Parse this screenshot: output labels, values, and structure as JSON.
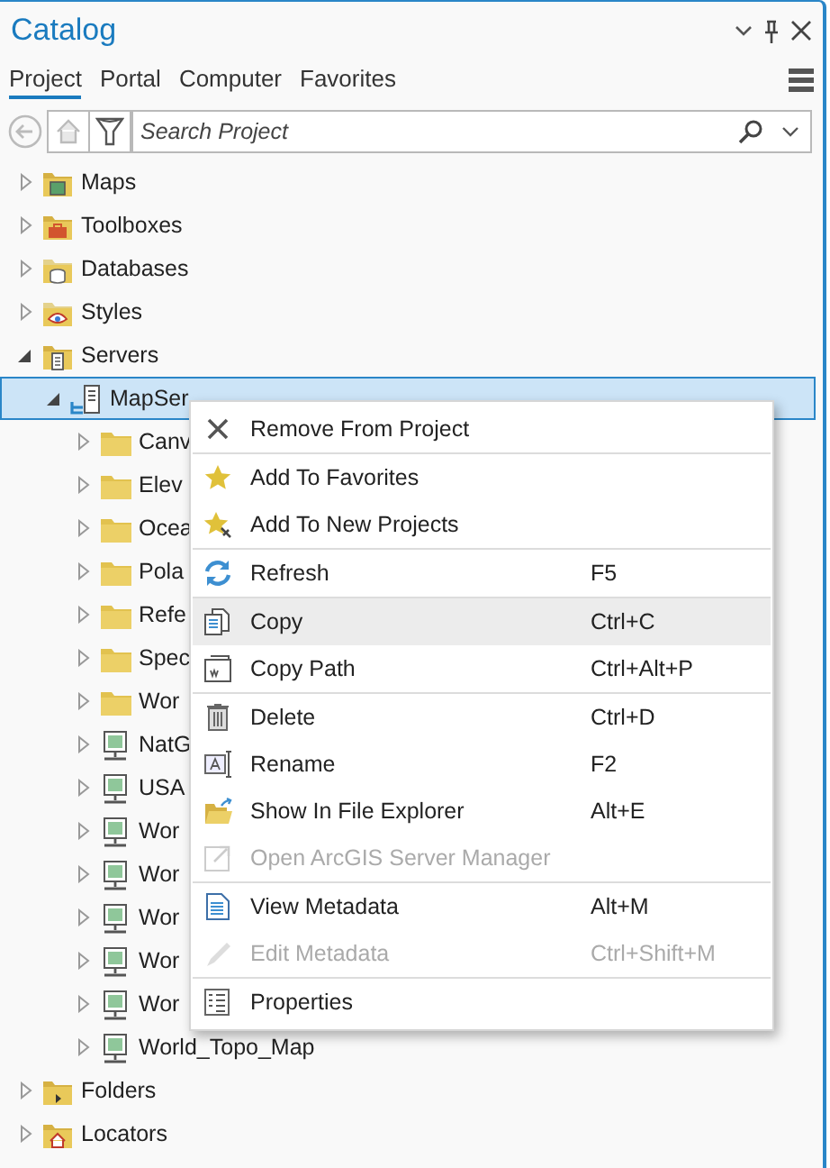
{
  "window": {
    "title": "Catalog"
  },
  "tabs": [
    {
      "label": "Project",
      "selected": true
    },
    {
      "label": "Portal",
      "selected": false
    },
    {
      "label": "Computer",
      "selected": false
    },
    {
      "label": "Favorites",
      "selected": false
    }
  ],
  "search": {
    "placeholder": "Search Project"
  },
  "tree": [
    {
      "label": "Maps",
      "kind": "maps",
      "expanded": false,
      "selected": false
    },
    {
      "label": "Toolboxes",
      "kind": "toolbox",
      "expanded": false,
      "selected": false
    },
    {
      "label": "Databases",
      "kind": "database",
      "expanded": false,
      "selected": false
    },
    {
      "label": "Styles",
      "kind": "style",
      "expanded": false,
      "selected": false
    },
    {
      "label": "Servers",
      "kind": "servers",
      "expanded": true,
      "selected": false,
      "children": [
        {
          "label": "MapSer",
          "kind": "connection",
          "expanded": true,
          "selected": true,
          "children": [
            {
              "label": "Canv",
              "kind": "folder",
              "expanded": false,
              "selected": false
            },
            {
              "label": "Elev",
              "kind": "folder",
              "expanded": false,
              "selected": false
            },
            {
              "label": "Ocea",
              "kind": "folder",
              "expanded": false,
              "selected": false
            },
            {
              "label": "Pola",
              "kind": "folder",
              "expanded": false,
              "selected": false
            },
            {
              "label": "Refe",
              "kind": "folder",
              "expanded": false,
              "selected": false
            },
            {
              "label": "Spec",
              "kind": "folder",
              "expanded": false,
              "selected": false
            },
            {
              "label": "Wor",
              "kind": "folder",
              "expanded": false,
              "selected": false
            },
            {
              "label": "NatG",
              "kind": "service",
              "expanded": false,
              "selected": false
            },
            {
              "label": "USA",
              "kind": "service",
              "expanded": false,
              "selected": false
            },
            {
              "label": "Wor",
              "kind": "service",
              "expanded": false,
              "selected": false
            },
            {
              "label": "Wor",
              "kind": "service",
              "expanded": false,
              "selected": false
            },
            {
              "label": "Wor",
              "kind": "service",
              "expanded": false,
              "selected": false
            },
            {
              "label": "Wor",
              "kind": "service",
              "expanded": false,
              "selected": false
            },
            {
              "label": "Wor",
              "kind": "service",
              "expanded": false,
              "selected": false
            },
            {
              "label": "World_Topo_Map",
              "kind": "service",
              "expanded": false,
              "selected": false
            }
          ]
        }
      ]
    },
    {
      "label": "Folders",
      "kind": "folders",
      "expanded": false,
      "selected": false
    },
    {
      "label": "Locators",
      "kind": "locators",
      "expanded": false,
      "selected": false
    }
  ],
  "context_menu": {
    "groups": [
      [
        {
          "label": "Remove From Project",
          "kind": "remove",
          "disabled": false,
          "highlighted": false
        }
      ],
      [
        {
          "label": "Add To Favorites",
          "kind": "star",
          "disabled": false,
          "highlighted": false
        },
        {
          "label": "Add To New Projects",
          "kind": "starpin",
          "disabled": false,
          "highlighted": false
        }
      ],
      [
        {
          "label": "Refresh",
          "shortcut": "F5",
          "kind": "refresh",
          "disabled": false,
          "highlighted": false
        }
      ],
      [
        {
          "label": "Copy",
          "shortcut": "Ctrl+C",
          "kind": "copy",
          "disabled": false,
          "highlighted": true
        },
        {
          "label": "Copy Path",
          "shortcut": "Ctrl+Alt+P",
          "kind": "copypath",
          "disabled": false,
          "highlighted": false
        }
      ],
      [
        {
          "label": "Delete",
          "shortcut": "Ctrl+D",
          "kind": "delete",
          "disabled": false,
          "highlighted": false
        },
        {
          "label": "Rename",
          "shortcut": "F2",
          "kind": "rename",
          "disabled": false,
          "highlighted": false
        },
        {
          "label": "Show In File Explorer",
          "shortcut": "Alt+E",
          "kind": "explorer",
          "disabled": false,
          "highlighted": false
        },
        {
          "label": "Open ArcGIS Server Manager",
          "kind": "external",
          "disabled": true,
          "highlighted": false
        }
      ],
      [
        {
          "label": "View Metadata",
          "shortcut": "Alt+M",
          "kind": "metadata",
          "disabled": false,
          "highlighted": false
        },
        {
          "label": "Edit Metadata",
          "shortcut": "Ctrl+Shift+M",
          "kind": "edit",
          "disabled": true,
          "highlighted": false
        }
      ],
      [
        {
          "label": "Properties",
          "kind": "properties",
          "disabled": false,
          "highlighted": false
        }
      ]
    ]
  }
}
